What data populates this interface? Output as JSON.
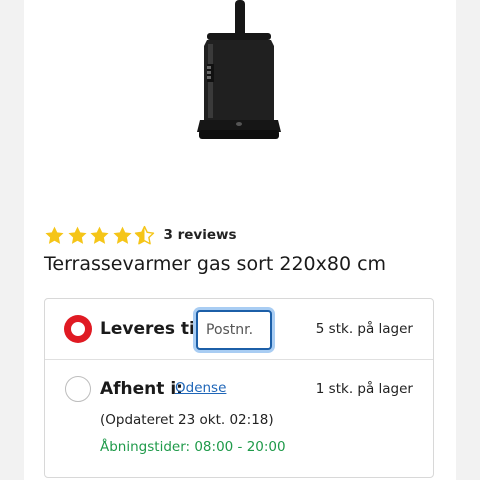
{
  "product": {
    "title": "Terrassevarmer gas sort 220x80 cm",
    "rating": 4.5,
    "reviews_label": "3 reviews",
    "image_icon": "patio-heater-image"
  },
  "delivery": {
    "label": "Leveres til:",
    "selected": true,
    "postal_placeholder": "Postnr.",
    "postal_value": "",
    "stock": "5 stk. på lager"
  },
  "pickup": {
    "label": "Afhent i:",
    "selected": false,
    "store": "Odense",
    "stock": "1 stk. på lager",
    "updated": "(Opdateret 23 okt. 02:18)",
    "hours": "Åbningstider: 08:00 - 20:00"
  },
  "colors": {
    "star": "#f5c518",
    "radio_selected": "#e01a23",
    "link": "#1f66b8",
    "hours": "#1f9a4a",
    "input_focus": "#1c5fa8"
  }
}
